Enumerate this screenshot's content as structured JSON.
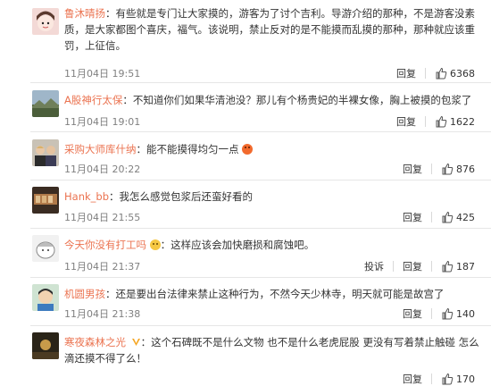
{
  "colors": {
    "name": "#eb7350",
    "time": "#808080",
    "separator": "#e6e6e6"
  },
  "comments": [
    {
      "user": "鲁沐晴扬",
      "text": "：有些就是专门让大家摸的，游客为了讨个吉利。导游介绍的那种，不是游客没素质，是大家都图个喜庆，福气。该说明，禁止反对的是不能摸而乱摸的那种，那种就应该重罚，上征信。",
      "time": "11月04日 19:51",
      "actions": [
        "回复"
      ],
      "likes": "6368",
      "avatar": "girl-avatar"
    },
    {
      "user": "A股神行太保",
      "text": "：不知道你们如果华清池没？那儿有个杨贵妃的半裸女像，胸上被摸的包浆了",
      "time": "11月04日 19:01",
      "actions": [
        "回复"
      ],
      "likes": "1622",
      "avatar": "landscape-avatar"
    },
    {
      "user": "采购大师库什纳",
      "text": "：能不能摸得均匀一点",
      "time": "11月04日 20:22",
      "actions": [
        "回复"
      ],
      "likes": "876",
      "avatar": "people-avatar",
      "emoji": "angry-emoji"
    },
    {
      "user": "Hank_bb",
      "text": "：我怎么感觉包浆后还蛮好看的",
      "time": "11月04日 21:55",
      "actions": [
        "回复"
      ],
      "likes": "425",
      "avatar": "food-avatar"
    },
    {
      "user": "今天你没有打工吗",
      "text": "：这样应该会加快磨损和腐蚀吧。",
      "time": "11月04日 21:37",
      "actions": [
        "投诉",
        "回复"
      ],
      "likes": "187",
      "avatar": "cartoon-avatar",
      "badge": "smile-emoji"
    },
    {
      "user": "机圆男孩",
      "text": "：还是要出台法律来禁止这种行为，不然今天少林寺，明天就可能是故宫了",
      "time": "11月04日 21:38",
      "actions": [
        "回复"
      ],
      "likes": "140",
      "avatar": "boy-avatar"
    },
    {
      "user": "寒夜森林之光",
      "text": "：这个石碑既不是什么文物 也不是什么老虎屁股 更没有写着禁止触碰 怎么滴还摸不得了么！",
      "time": "",
      "actions": [
        "回复"
      ],
      "likes": "170",
      "avatar": "dark-avatar",
      "badge": "vip-icon"
    }
  ]
}
